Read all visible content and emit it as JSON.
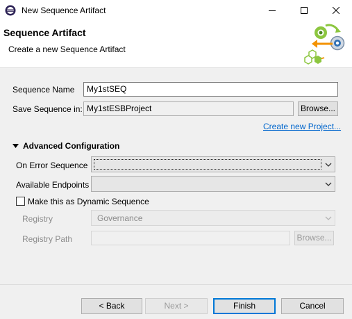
{
  "window": {
    "title": "New Sequence Artifact",
    "icon": "eclipse-icon",
    "controls": [
      "minimize-icon",
      "maximize-icon",
      "close-icon"
    ]
  },
  "banner": {
    "title": "Sequence Artifact",
    "subtitle": "Create a new Sequence Artifact",
    "art_icon": "sequence-artifact-wizard-icon"
  },
  "form": {
    "sequence_name_label": "Sequence Name",
    "sequence_name_value": "My1stSEQ",
    "save_in_label": "Save Sequence in:",
    "save_in_value": "My1stESBProject",
    "browse_label": "Browse...",
    "create_project_link": "Create new Project..."
  },
  "advanced": {
    "section_label": "Advanced Configuration",
    "expanded": true,
    "on_error_label": "On Error Sequence",
    "on_error_value": "",
    "endpoints_label": "Available Endpoints",
    "endpoints_value": "",
    "dynamic_checkbox_label": "Make this as Dynamic Sequence",
    "dynamic_checked": false,
    "registry_label": "Registry",
    "registry_value": "Governance",
    "registry_path_label": "Registry Path",
    "registry_path_value": "",
    "registry_browse_label": "Browse..."
  },
  "footer": {
    "back_label": "< Back",
    "next_label": "Next >",
    "finish_label": "Finish",
    "cancel_label": "Cancel"
  },
  "colors": {
    "accent": "#0078d7",
    "link": "#0066cc",
    "dialog_bg": "#f0f0f0"
  }
}
